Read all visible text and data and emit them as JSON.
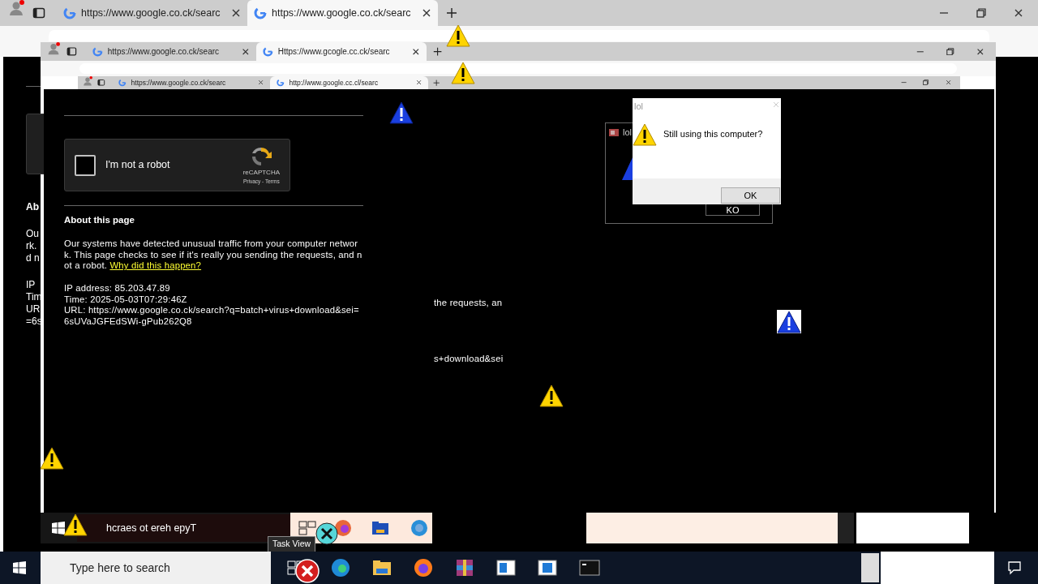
{
  "windows": [
    {
      "tabs": [
        {
          "label": "https://www.google.co.ck/searc",
          "selected": false
        },
        {
          "label": "https://www.google.co.ck/searc",
          "selected": true
        }
      ]
    },
    {
      "tabs": [
        {
          "label": "https://www.google.co.ck/searc",
          "selected": false
        },
        {
          "label": "Https://www.gcogle.cc.ck/searc",
          "selected": true
        }
      ]
    },
    {
      "tabs": [
        {
          "label": "https://www.google.co.ck/searc",
          "selected": false
        },
        {
          "label": "http://www.google.cc.cl/searc",
          "selected": true
        }
      ]
    }
  ],
  "behind_fragments": [
    "Ab",
    "Ou",
    "rk.",
    "d n",
    "IP",
    "Tim",
    "UR",
    "=6s"
  ],
  "page": {
    "checkbox": {
      "label": "I'm not a robot",
      "checked": false
    },
    "recaptcha": "reCAPTCHA",
    "recaptcha_links": "Privacy - Terms",
    "heading": "About this page",
    "paragraph": "Our systems have detected unusual traffic from your computer network. This page checks to see if it's really you sending the requests, and not a robot. ",
    "link": "Why did this happen?",
    "details": [
      "IP address: 85.203.47.89",
      "Time: 2025-05-03T07:29:46Z",
      "URL: https://www.google.co.ck/search?q=batch+virus+download&sei=6sUVaJGFEdSWi-gPub262Q8"
    ]
  },
  "stray_texts": [
    "the requests, an",
    "s+download&sei"
  ],
  "dialogs": [
    {
      "title": "lol",
      "button": "KO"
    },
    {
      "title": "lol",
      "message": "Still using this computer?",
      "button": "OK"
    }
  ],
  "inner_taskbar": {
    "search": "hcraes ot ereh epyT",
    "tooltip": "Task View"
  },
  "taskbar": {
    "search_placeholder": "Type here to search"
  }
}
